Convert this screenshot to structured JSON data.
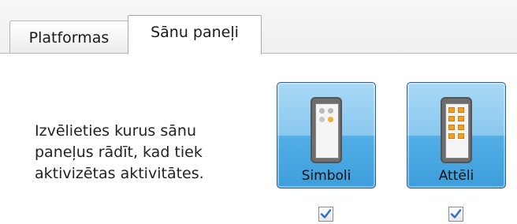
{
  "tabs": [
    {
      "label": "Platformas",
      "active": false
    },
    {
      "label": "Sānu paneļi",
      "active": true
    }
  ],
  "description": "Izvēlieties kurus sānu paneļus rādīt, kad tiek aktivizētas aktivitātes.",
  "panels": [
    {
      "label": "Simboli",
      "icon": "device-symbols-icon",
      "checked": true
    },
    {
      "label": "Attēli",
      "icon": "device-images-icon",
      "checked": true
    }
  ],
  "colors": {
    "button_top": "#a9d9f5",
    "button_bottom": "#3d9edb",
    "button_border": "#2e5f8d",
    "check": "#2d6fc2"
  }
}
